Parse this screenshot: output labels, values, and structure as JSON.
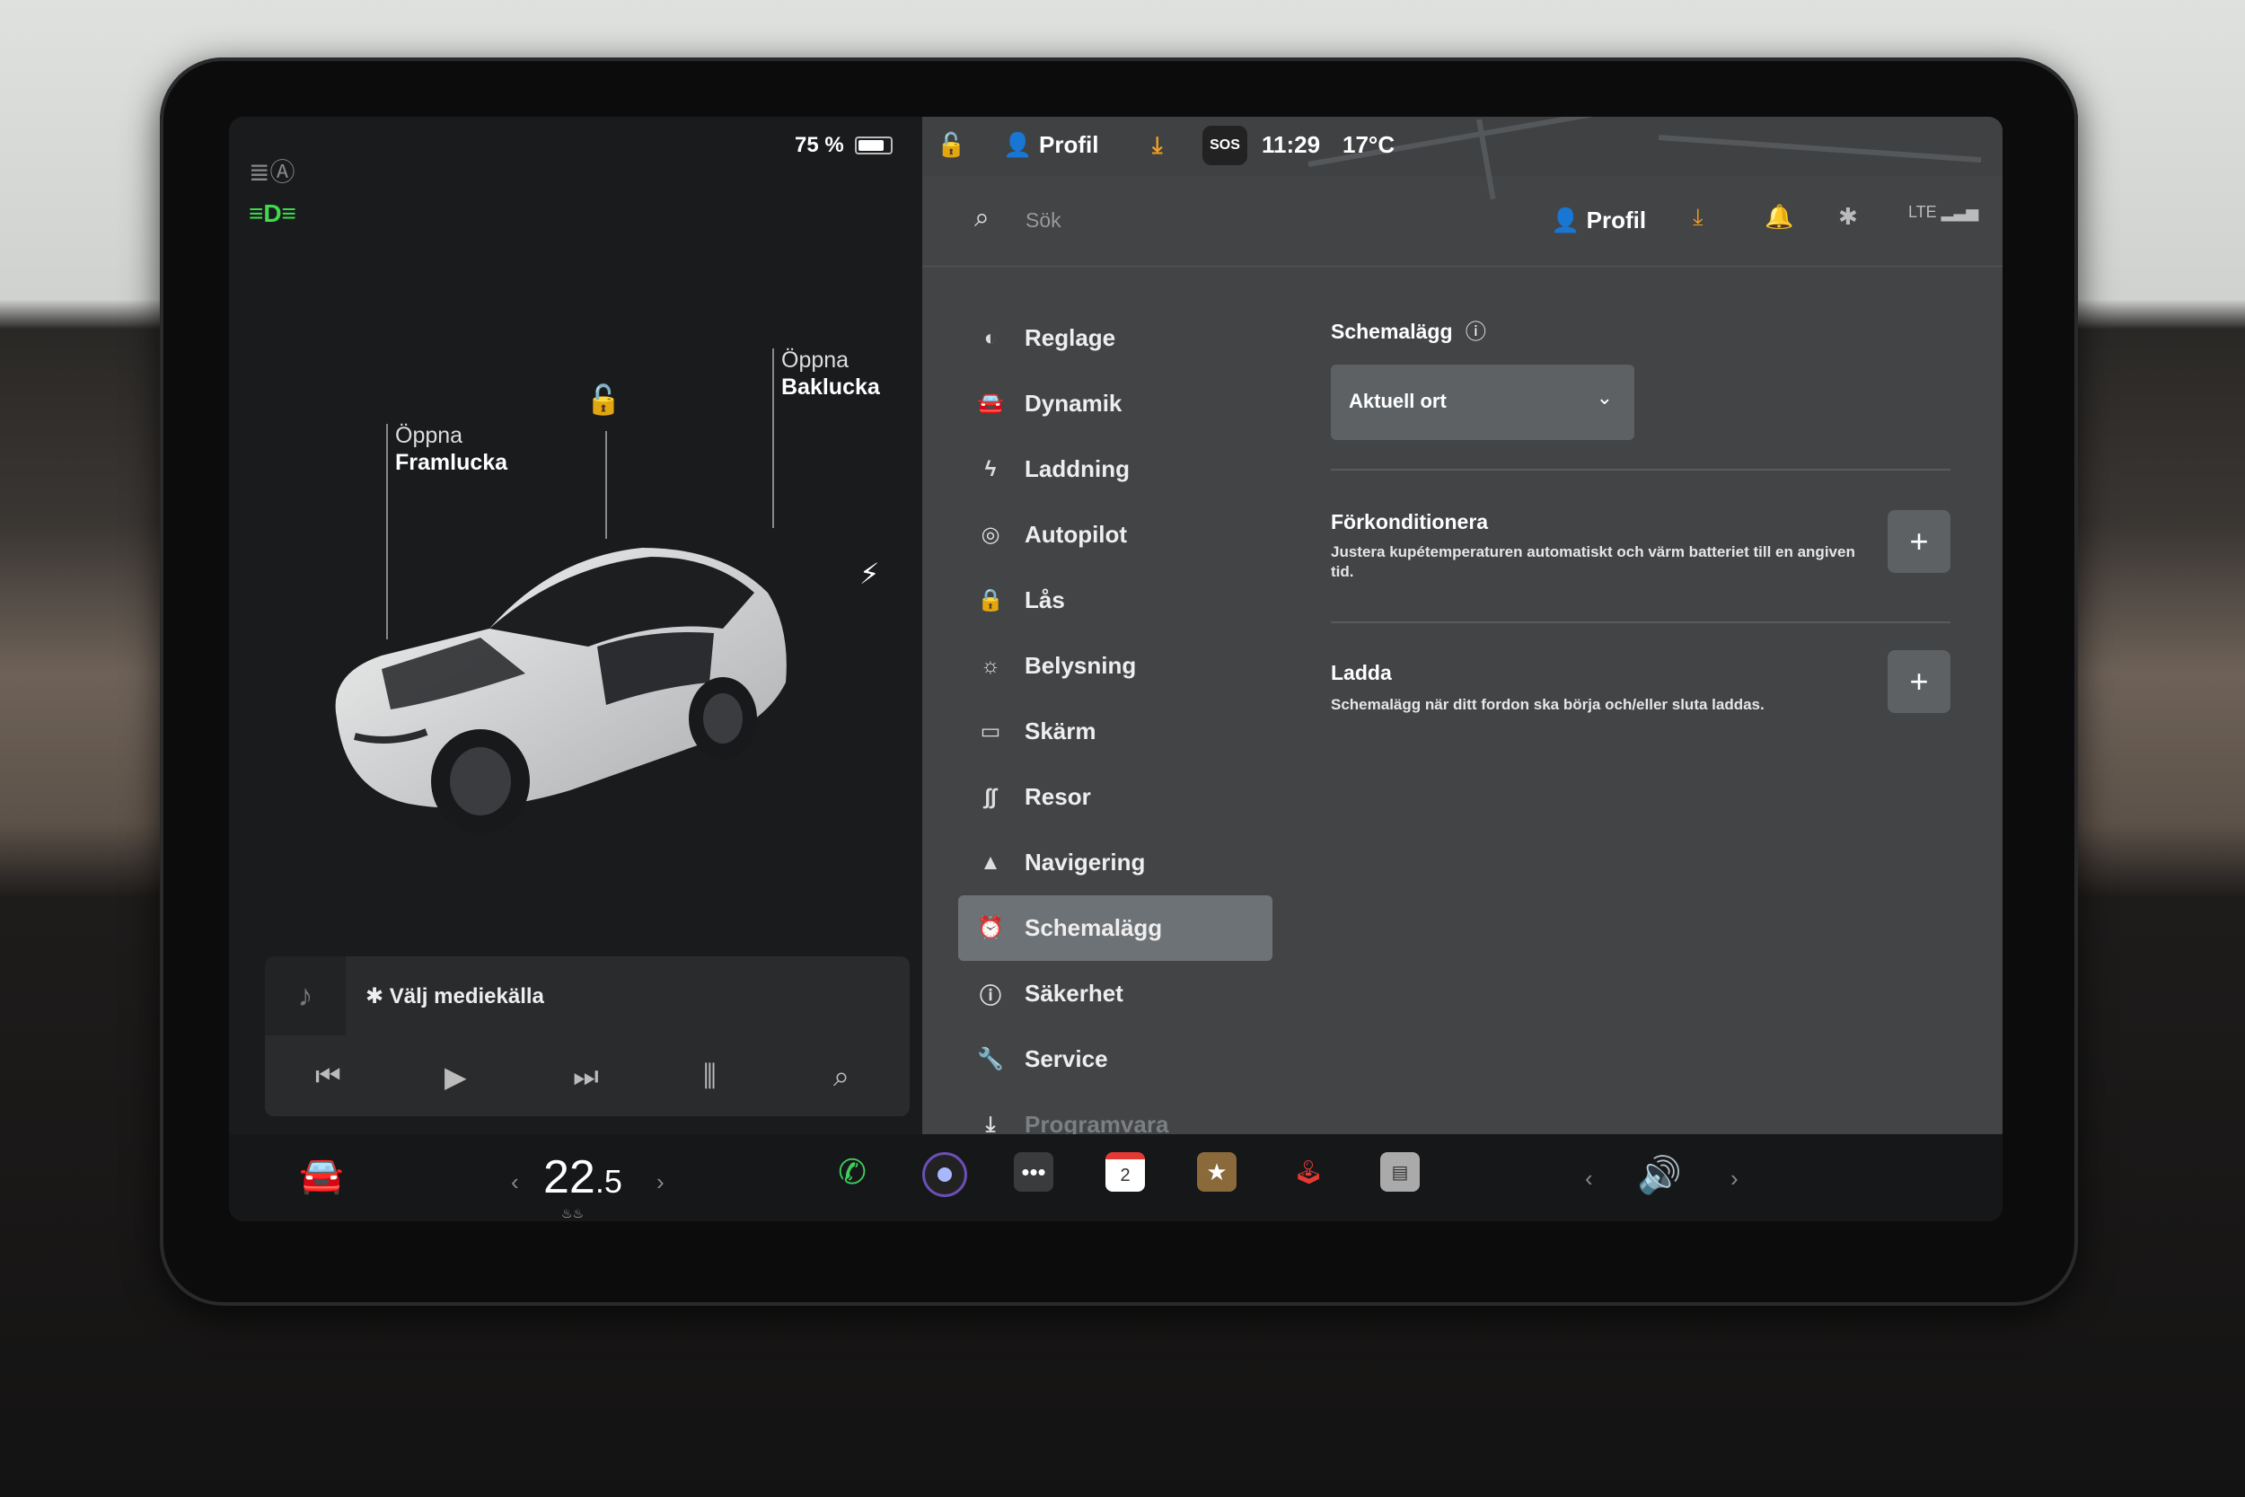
{
  "status_left": {
    "battery_percent": "75 %",
    "battery_level": 0.75
  },
  "car": {
    "label_front_1": "Öppna",
    "label_front_2": "Framlucka",
    "label_rear_1": "Öppna",
    "label_rear_2": "Baklucka"
  },
  "media": {
    "source_label": "Välj mediekälla"
  },
  "topbar": {
    "profile": "Profil",
    "sos": "SOS",
    "time": "11:29",
    "temperature": "17°C"
  },
  "search": {
    "placeholder": "Sök",
    "profile": "Profil"
  },
  "menu": [
    {
      "label": "Reglage",
      "icon": "toggle-icon"
    },
    {
      "label": "Dynamik",
      "icon": "car-icon"
    },
    {
      "label": "Laddning",
      "icon": "lightning-icon"
    },
    {
      "label": "Autopilot",
      "icon": "steering-wheel-icon"
    },
    {
      "label": "Lås",
      "icon": "lock-icon"
    },
    {
      "label": "Belysning",
      "icon": "sun-icon"
    },
    {
      "label": "Skärm",
      "icon": "display-icon"
    },
    {
      "label": "Resor",
      "icon": "trips-icon"
    },
    {
      "label": "Navigering",
      "icon": "navigation-icon"
    },
    {
      "label": "Schemalägg",
      "icon": "alarm-clock-icon",
      "active": true
    },
    {
      "label": "Säkerhet",
      "icon": "alert-icon"
    },
    {
      "label": "Service",
      "icon": "wrench-icon"
    },
    {
      "label": "Programvara",
      "icon": "download-icon"
    }
  ],
  "schedule": {
    "title": "Schemalägg",
    "location_value": "Aktuell ort",
    "precondition_title": "Förkonditionera",
    "precondition_desc": "Justera kupétemperaturen automatiskt och värm batteriet till en angiven tid.",
    "charge_title": "Ladda",
    "charge_desc": "Schemalägg när ditt fordon ska börja och/eller sluta laddas."
  },
  "bottom": {
    "temp_whole": "22",
    "temp_decimal": ".5",
    "calendar_day": "2"
  },
  "colors": {
    "accent_orange": "#f0a020",
    "green_light": "#3ddc4a",
    "phone_green": "#3ecf5a"
  }
}
